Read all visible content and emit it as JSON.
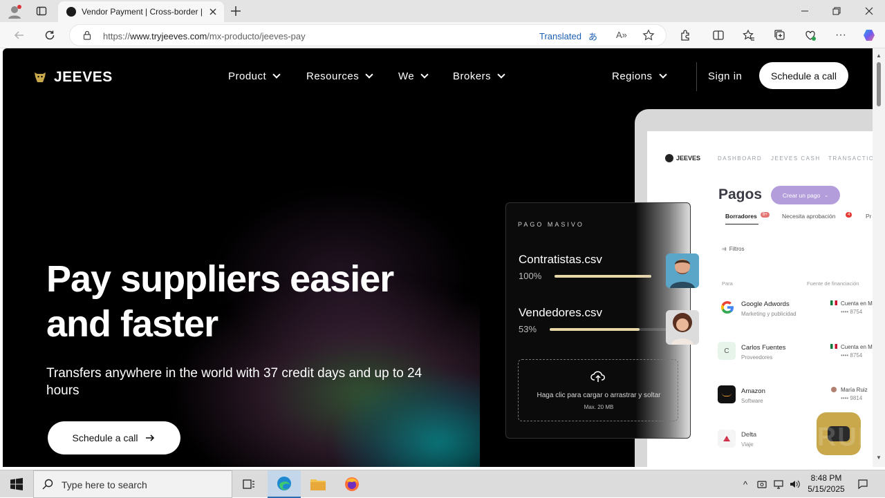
{
  "browser": {
    "tab_title": "Vendor Payment | Cross-border |",
    "url_prefix": "https://",
    "url_domain": "www.tryjeeves.com",
    "url_path": "/mx-producto/jeeves-pay",
    "translated_label": "Translated"
  },
  "site": {
    "logo_text": "JEEVES",
    "nav": {
      "product": "Product",
      "resources": "Resources",
      "we": "We",
      "brokers": "Brokers",
      "regions": "Regions",
      "sign_in": "Sign in",
      "schedule_call": "Schedule a call"
    },
    "hero": {
      "title_line1": "Pay suppliers easier",
      "title_line2": "and faster",
      "subtitle": "Transfers anywhere in the world with 37 credit days and up to 24 hours",
      "cta": "Schedule a call"
    },
    "dashboard": {
      "logo": "JEEVES",
      "tabs": [
        "DASHBOARD",
        "JEEVES CASH",
        "TRANSACTION"
      ],
      "title": "Pagos",
      "create_button": "Crear un pago",
      "subtabs": {
        "drafts": "Borradores",
        "drafts_badge": "8+",
        "approval": "Necesita aprobación",
        "approval_badge": "4",
        "more": "Pr"
      },
      "filters": "Filtros",
      "col_to": "Para",
      "col_source": "Fuente de financiación",
      "rows": [
        {
          "name": "Google Adwords",
          "sub": "Marketing y publicidad",
          "right": "Cuenta en M",
          "mask": "•••• 8754"
        },
        {
          "name": "Carlos Fuentes",
          "sub": "Proveedores",
          "right": "Cuenta en M",
          "mask": "•••• 8754",
          "initial": "C"
        },
        {
          "name": "Amazon",
          "sub": "Software",
          "right": "María Ruiz",
          "mask": "•••• 9814"
        },
        {
          "name": "Delta",
          "sub": "Viaje"
        }
      ]
    },
    "mass_payment": {
      "label": "PAGO MASIVO",
      "files": [
        {
          "name": "Contratistas.csv",
          "percent": "100%",
          "progress": 1.0
        },
        {
          "name": "Vendedores.csv",
          "percent": "53%",
          "progress": 0.53
        }
      ],
      "upload_text": "Haga clic para cargar o arrastrar y soltar",
      "max_size": "Max. 20 MB"
    }
  },
  "taskbar": {
    "search_placeholder": "Type here to search",
    "time": "8:48 PM",
    "date": "5/15/2025"
  },
  "colors": {
    "accent_gold": "#c8a84a",
    "progress_fill": "#e8d8a8",
    "dashboard_button": "#b39ddb",
    "link_blue": "#1a5fb4"
  }
}
